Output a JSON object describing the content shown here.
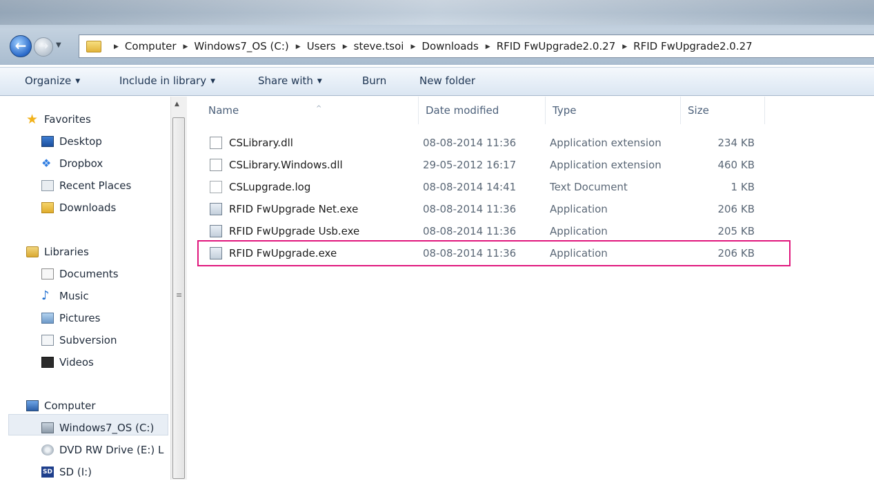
{
  "breadcrumb": [
    "Computer",
    "Windows7_OS (C:)",
    "Users",
    "steve.tsoi",
    "Downloads",
    "RFID FwUpgrade2.0.27",
    "RFID FwUpgrade2.0.27"
  ],
  "toolbar": {
    "organize": "Organize",
    "include_in_library": "Include in library",
    "share_with": "Share with",
    "burn": "Burn",
    "new_folder": "New folder"
  },
  "nav": {
    "favorites": "Favorites",
    "desktop": "Desktop",
    "dropbox": "Dropbox",
    "recent_places": "Recent Places",
    "downloads": "Downloads",
    "libraries": "Libraries",
    "documents": "Documents",
    "music": "Music",
    "pictures": "Pictures",
    "subversion": "Subversion",
    "videos": "Videos",
    "computer": "Computer",
    "windows7_os": "Windows7_OS (C:)",
    "dvd_drive": "DVD RW Drive (E:) L",
    "sd": "SD (I:)"
  },
  "columns": {
    "name": "Name",
    "date": "Date modified",
    "type": "Type",
    "size": "Size"
  },
  "files": [
    {
      "name": "CSLibrary.dll",
      "date": "08-08-2014 11:36",
      "type": "Application extension",
      "size": "234 KB",
      "icon": "dll-file-icon"
    },
    {
      "name": "CSLibrary.Windows.dll",
      "date": "29-05-2012 16:17",
      "type": "Application extension",
      "size": "460 KB",
      "icon": "dll-file-icon"
    },
    {
      "name": "CSLupgrade.log",
      "date": "08-08-2014 14:41",
      "type": "Text Document",
      "size": "1 KB",
      "icon": "text-file-icon"
    },
    {
      "name": "RFID FwUpgrade Net.exe",
      "date": "08-08-2014 11:36",
      "type": "Application",
      "size": "206 KB",
      "icon": "exe-file-icon"
    },
    {
      "name": "RFID FwUpgrade Usb.exe",
      "date": "08-08-2014 11:36",
      "type": "Application",
      "size": "205 KB",
      "icon": "exe-file-icon"
    },
    {
      "name": "RFID FwUpgrade.exe",
      "date": "08-08-2014 11:36",
      "type": "Application",
      "size": "206 KB",
      "icon": "exe-file-icon"
    }
  ],
  "highlighted_file": "RFID FwUpgrade.exe",
  "colors": {
    "highlight_border": "#e0167c",
    "toolbar_text": "#1e3553",
    "selected_nav_bg": "#e8eef5"
  }
}
